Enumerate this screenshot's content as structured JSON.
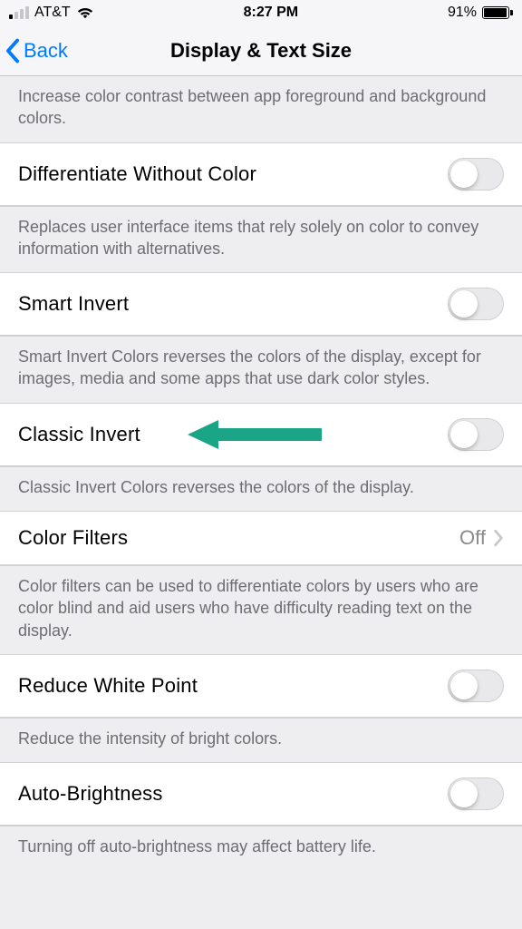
{
  "status": {
    "carrier": "AT&T",
    "time": "8:27 PM",
    "battery_pct": "91%"
  },
  "nav": {
    "back": "Back",
    "title": "Display & Text Size"
  },
  "rows": {
    "contrast_footer": "Increase color contrast between app foreground and background colors.",
    "diff_label": "Differentiate Without Color",
    "diff_footer": "Replaces user interface items that rely solely on color to convey information with alternatives.",
    "smart_label": "Smart Invert",
    "smart_footer": "Smart Invert Colors reverses the colors of the display, except for images, media and some apps that use dark color styles.",
    "classic_label": "Classic Invert",
    "classic_footer": "Classic Invert Colors reverses the colors of the display.",
    "filters_label": "Color Filters",
    "filters_value": "Off",
    "filters_footer": "Color filters can be used to differentiate colors by users who are color blind and aid users who have difficulty reading text on the display.",
    "whitepoint_label": "Reduce White Point",
    "whitepoint_footer": "Reduce the intensity of bright colors.",
    "autobright_label": "Auto-Brightness",
    "autobright_footer": "Turning off auto-brightness may affect battery life."
  },
  "colors": {
    "arrow": "#1aa586"
  }
}
